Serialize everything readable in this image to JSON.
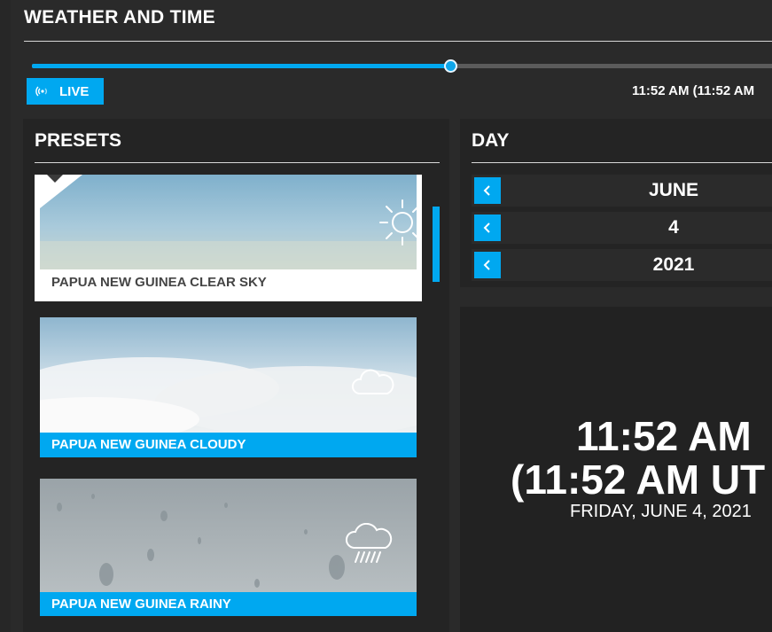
{
  "header": {
    "title": "WEATHER AND TIME"
  },
  "timeline": {
    "progress": 0.555,
    "live_label": "LIVE",
    "time_text": "11:52 AM (11:52 AM"
  },
  "presets": {
    "title": "PRESETS",
    "items": [
      {
        "label": "PAPUA NEW GUINEA CLEAR SKY",
        "icon": "sun-icon",
        "selected": true
      },
      {
        "label": "PAPUA NEW GUINEA CLOUDY",
        "icon": "cloud-icon",
        "selected": false
      },
      {
        "label": "PAPUA NEW GUINEA RAINY",
        "icon": "rain-cloud-icon",
        "selected": false
      }
    ]
  },
  "day": {
    "title": "DAY",
    "month": "JUNE",
    "day": "4",
    "year": "2021"
  },
  "clock": {
    "time": "11:52 AM",
    "utc": "(11:52 AM UT",
    "date": "FRIDAY, JUNE 4, 2021"
  },
  "colors": {
    "accent": "#00a8f0",
    "background": "#262626",
    "panel": "#242424"
  }
}
